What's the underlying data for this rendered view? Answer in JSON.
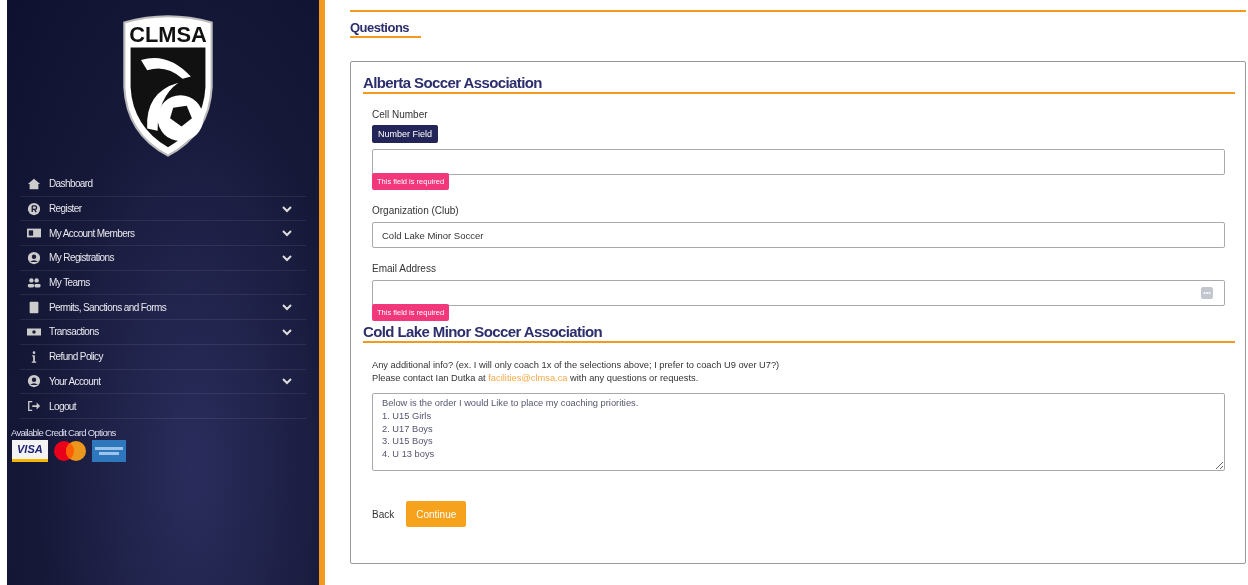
{
  "sidebar": {
    "logo_text": "CLMSA",
    "menu": [
      {
        "label": "Dashboard",
        "kind": "house",
        "expandable": false
      },
      {
        "label": "Register",
        "kind": "r-circle",
        "expandable": true
      },
      {
        "label": "My Account Members",
        "kind": "id-card",
        "expandable": true
      },
      {
        "label": "My Registrations",
        "kind": "user-circle",
        "expandable": true
      },
      {
        "label": "My Teams",
        "kind": "users",
        "expandable": false
      },
      {
        "label": "Permits, Sanctions and Forms",
        "kind": "clipboard",
        "expandable": true
      },
      {
        "label": "Transactions",
        "kind": "bill",
        "expandable": true
      },
      {
        "label": "Refund Policy",
        "kind": "info",
        "expandable": false
      },
      {
        "label": "Your Account",
        "kind": "user-circle",
        "expandable": true
      },
      {
        "label": "Logout",
        "kind": "logout",
        "expandable": false
      }
    ],
    "cards_title": "Available Credit Card Options",
    "cards": [
      {
        "kind": "visa",
        "label": "VISA"
      },
      {
        "kind": "mastercard"
      },
      {
        "kind": "amex"
      }
    ]
  },
  "page_title": "Questions",
  "sections": [
    {
      "title": "Alberta Soccer Association",
      "fields": [
        {
          "kind": "input",
          "label": "Cell Number",
          "badge": "Number Field",
          "error": "This field is required",
          "autofill_icon": false
        },
        {
          "kind": "input",
          "label": "Organization (Club)",
          "value": "Cold Lake Minor Soccer",
          "autofill_icon": false
        },
        {
          "kind": "input",
          "label": "Email Address",
          "error": "This field is required",
          "autofill_icon": true
        }
      ]
    },
    {
      "title": "Cold Lake Minor Soccer Association",
      "fields": [
        {
          "kind": "textarea",
          "label_lines": [
            "Any additional info? (ex. I will only coach 1x of the selections above; I prefer to coach U9 over U7?)"
          ],
          "contact": {
            "before": "Please contact Ian Dutka at",
            "link": "facilities@clmsa.ca",
            "after": "with any questions or requests."
          },
          "value": "Below is the order I would Like to place my coaching priorities.\n1. U15 Girls\n2. U17 Boys\n3. U15 Boys\n4. U 13 boys"
        }
      ]
    }
  ],
  "buttons": {
    "back": "Back",
    "continue": "Continue"
  }
}
